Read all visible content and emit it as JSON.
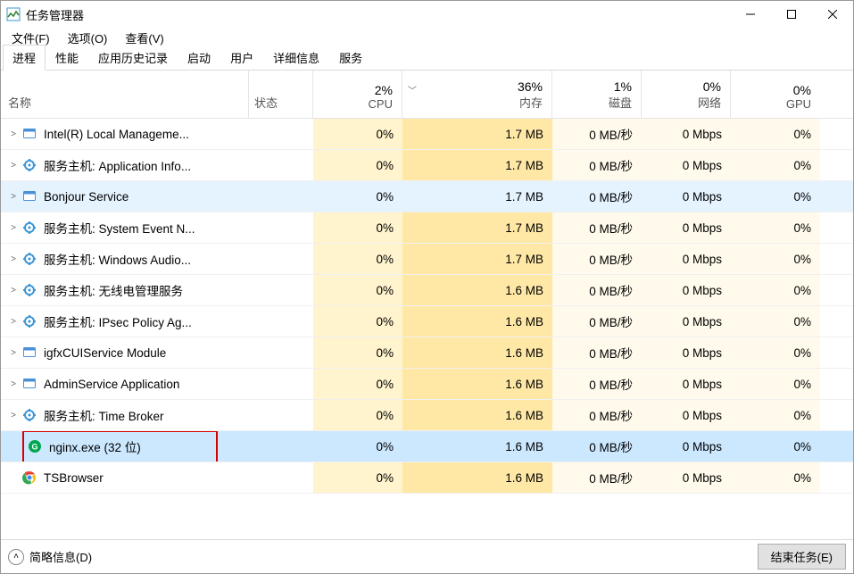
{
  "window": {
    "title": "任务管理器"
  },
  "menu": {
    "file": "文件(F)",
    "options": "选项(O)",
    "view": "查看(V)"
  },
  "tabs": [
    "进程",
    "性能",
    "应用历史记录",
    "启动",
    "用户",
    "详细信息",
    "服务"
  ],
  "columns": {
    "name": "名称",
    "status": "状态",
    "cpu": {
      "metric": "2%",
      "label": "CPU"
    },
    "mem": {
      "metric": "36%",
      "label": "内存"
    },
    "disk": {
      "metric": "1%",
      "label": "磁盘"
    },
    "net": {
      "metric": "0%",
      "label": "网络"
    },
    "gpu": {
      "metric": "0%",
      "label": "GPU"
    }
  },
  "rows": [
    {
      "expandable": true,
      "icon": "app",
      "name": "Intel(R) Local Manageme...",
      "cpu": "0%",
      "mem": "1.7 MB",
      "disk": "0 MB/秒",
      "net": "0 Mbps",
      "gpu": "0%",
      "state": ""
    },
    {
      "expandable": true,
      "icon": "svc",
      "name": "服务主机: Application Info...",
      "cpu": "0%",
      "mem": "1.7 MB",
      "disk": "0 MB/秒",
      "net": "0 Mbps",
      "gpu": "0%",
      "state": ""
    },
    {
      "expandable": true,
      "icon": "app",
      "name": "Bonjour Service",
      "cpu": "0%",
      "mem": "1.7 MB",
      "disk": "0 MB/秒",
      "net": "0 Mbps",
      "gpu": "0%",
      "state": "hover"
    },
    {
      "expandable": true,
      "icon": "svc",
      "name": "服务主机: System Event N...",
      "cpu": "0%",
      "mem": "1.7 MB",
      "disk": "0 MB/秒",
      "net": "0 Mbps",
      "gpu": "0%",
      "state": ""
    },
    {
      "expandable": true,
      "icon": "svc",
      "name": "服务主机: Windows Audio...",
      "cpu": "0%",
      "mem": "1.7 MB",
      "disk": "0 MB/秒",
      "net": "0 Mbps",
      "gpu": "0%",
      "state": ""
    },
    {
      "expandable": true,
      "icon": "svc",
      "name": "服务主机: 无线电管理服务",
      "cpu": "0%",
      "mem": "1.6 MB",
      "disk": "0 MB/秒",
      "net": "0 Mbps",
      "gpu": "0%",
      "state": ""
    },
    {
      "expandable": true,
      "icon": "svc",
      "name": "服务主机: IPsec Policy Ag...",
      "cpu": "0%",
      "mem": "1.6 MB",
      "disk": "0 MB/秒",
      "net": "0 Mbps",
      "gpu": "0%",
      "state": ""
    },
    {
      "expandable": true,
      "icon": "app",
      "name": "igfxCUIService Module",
      "cpu": "0%",
      "mem": "1.6 MB",
      "disk": "0 MB/秒",
      "net": "0 Mbps",
      "gpu": "0%",
      "state": ""
    },
    {
      "expandable": true,
      "icon": "app",
      "name": "AdminService Application",
      "cpu": "0%",
      "mem": "1.6 MB",
      "disk": "0 MB/秒",
      "net": "0 Mbps",
      "gpu": "0%",
      "state": ""
    },
    {
      "expandable": true,
      "icon": "svc",
      "name": "服务主机: Time Broker",
      "cpu": "0%",
      "mem": "1.6 MB",
      "disk": "0 MB/秒",
      "net": "0 Mbps",
      "gpu": "0%",
      "state": ""
    },
    {
      "expandable": false,
      "icon": "nginx",
      "name": "nginx.exe (32 位)",
      "cpu": "0%",
      "mem": "1.6 MB",
      "disk": "0 MB/秒",
      "net": "0 Mbps",
      "gpu": "0%",
      "state": "selected",
      "redbox": true
    },
    {
      "expandable": false,
      "icon": "chrome",
      "name": "TSBrowser",
      "cpu": "0%",
      "mem": "1.6 MB",
      "disk": "0 MB/秒",
      "net": "0 Mbps",
      "gpu": "0%",
      "state": ""
    }
  ],
  "footer": {
    "fewer": "简略信息(D)",
    "end": "结束任务(E)"
  }
}
